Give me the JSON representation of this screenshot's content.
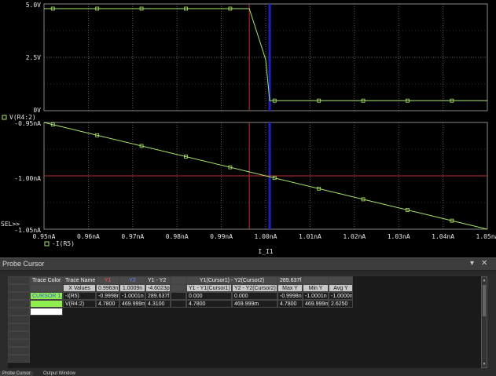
{
  "plot": {
    "upper": {
      "y_ticks": [
        "5.0V",
        "2.5V",
        "0V"
      ],
      "legend": "V(R4:2)"
    },
    "lower": {
      "y_ticks": [
        "-0.95nA",
        "-1.00nA",
        "-1.05nA"
      ],
      "sel_label": "SEL>>",
      "legend": "-I(R5)"
    },
    "x_ticks": [
      "0.95nA",
      "0.96nA",
      "0.97nA",
      "0.98nA",
      "0.99nA",
      "1.00nA",
      "1.01nA",
      "1.02nA",
      "1.03nA",
      "1.04nA",
      "1.05nA"
    ],
    "x_axis_label": "I_I1",
    "colors": {
      "trace": "#a8e66a",
      "cursor1": "#c03030",
      "cursor2": "#2020c8",
      "grid": "#5a5a5a"
    }
  },
  "chart_data": [
    {
      "type": "line",
      "series": [
        {
          "name": "V(R4:2)",
          "color": "#a8e66a",
          "x": [
            0.95,
            0.9963,
            1.0,
            1.0009,
            1.05
          ],
          "y": [
            4.78,
            4.78,
            2.39,
            0.47,
            0.47
          ]
        }
      ],
      "xlim": [
        0.95,
        1.05
      ],
      "ylim": [
        0,
        5.0
      ],
      "y_ticks": [
        0,
        2.5,
        5.0
      ]
    },
    {
      "type": "line",
      "series": [
        {
          "name": "-I(R5)",
          "color": "#a8e66a",
          "x": [
            0.95,
            1.05
          ],
          "y": [
            -0.95,
            -1.05
          ]
        }
      ],
      "xlim": [
        0.95,
        1.05
      ],
      "ylim": [
        -1.05,
        -0.95
      ],
      "y_ticks": [
        -1.05,
        -1.0,
        -0.95
      ]
    }
  ],
  "cursors": {
    "c1": 0.9963,
    "c2": 1.0009
  },
  "probe": {
    "title": "Probe Cursor",
    "pin_icon": "pin",
    "close_icon": "x",
    "headers": {
      "trace_color": "Trace Color",
      "trace_name": "Trace Name",
      "y1": "Y1",
      "y2": "Y2",
      "y1_minus_y2": "Y1 - Y2",
      "group": "Y1(Cursor1) - Y2(Cursor2)",
      "group_value": "289.637f"
    },
    "subheaders": {
      "x_values": "X Values",
      "y1_x": "0.9963n",
      "y2_x": "1.0009n",
      "diff_x": "-4.6023p",
      "y1_minus_y1": "Y1 - Y1(Cursor1)",
      "y2_minus_y2": "Y2 - Y2(Cursor2)",
      "max_y": "Max Y",
      "min_y": "Min Y",
      "avg_y": "Avg Y"
    },
    "rows": [
      {
        "color_label": "CURSOR 1,2",
        "name": "-I(R5)",
        "y1": "-0.9998n",
        "y2": "-1.0001n",
        "diff": "289.637f",
        "y1y1": "0.000",
        "y2y2": "0.000",
        "max": "-0.9998n",
        "min": "-1.0001n",
        "avg": "-1.0000n"
      },
      {
        "color_label": "",
        "name": "V(R4:2)",
        "y1": "4.7800",
        "y2": "469.999m",
        "diff": "4.3100",
        "y1y1": "4.7800",
        "y2y2": "469.999m",
        "max": "4.7800",
        "min": "469.999m",
        "avg": "2.6250"
      }
    ],
    "tabs": [
      "Probe Cursor",
      "Output Window"
    ]
  }
}
